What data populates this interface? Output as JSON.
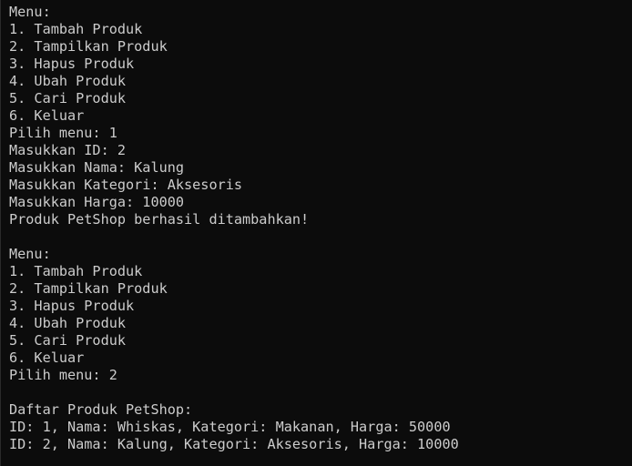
{
  "terminal": {
    "lines": [
      "Menu:",
      "1. Tambah Produk",
      "2. Tampilkan Produk",
      "3. Hapus Produk",
      "4. Ubah Produk",
      "5. Cari Produk",
      "6. Keluar",
      "Pilih menu: 1",
      "Masukkan ID: 2",
      "Masukkan Nama: Kalung",
      "Masukkan Kategori: Aksesoris",
      "Masukkan Harga: 10000",
      "Produk PetShop berhasil ditambahkan!",
      "",
      "Menu:",
      "1. Tambah Produk",
      "2. Tampilkan Produk",
      "3. Hapus Produk",
      "4. Ubah Produk",
      "5. Cari Produk",
      "6. Keluar",
      "Pilih menu: 2",
      "",
      "Daftar Produk PetShop:",
      "ID: 1, Nama: Whiskas, Kategori: Makanan, Harga: 50000",
      "ID: 2, Nama: Kalung, Kategori: Aksesoris, Harga: 10000"
    ]
  },
  "colors": {
    "background": "#0c0c0c",
    "foreground": "#cccccc"
  }
}
